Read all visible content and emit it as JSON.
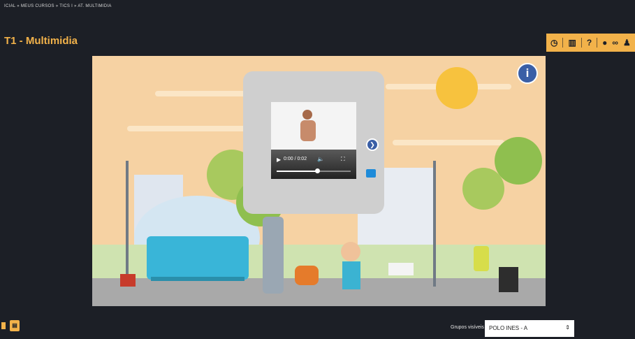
{
  "header": {
    "breadcrumb": "ICIAL » MEUS CURSOS » TICS I » AT. MULTIMIDIA",
    "title": "T1 - Multimidia"
  },
  "toolbar": {
    "icons": [
      "clock-icon",
      "chart-icon",
      "help-icon",
      "eye-icon",
      "link-icon",
      "user-icon"
    ],
    "help_label": "?"
  },
  "video": {
    "time": "0:00 / 0:02",
    "progress": 0.55
  },
  "footer": {
    "group_label": "Grupos visíveis",
    "group_value": "POLO INES - A"
  },
  "colors": {
    "accent": "#f2b24a",
    "background": "#1c1f26",
    "scene_sky": "#f6d2a3",
    "popup": "#cfcfcf",
    "info_blue": "#3a5fa6"
  }
}
